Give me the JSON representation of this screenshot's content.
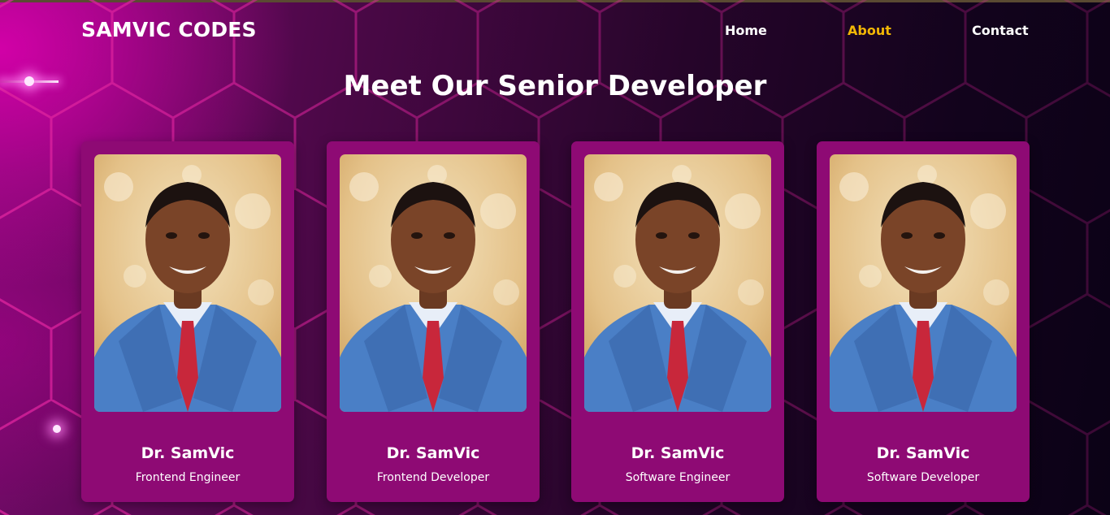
{
  "header": {
    "logo": "SAMVIC CODES",
    "nav": [
      {
        "label": "Home",
        "active": false
      },
      {
        "label": "About",
        "active": true
      },
      {
        "label": "Contact",
        "active": false
      }
    ]
  },
  "main": {
    "title": "Meet Our Senior Developer",
    "cards": [
      {
        "name": "Dr. SamVic",
        "role": "Frontend Engineer"
      },
      {
        "name": "Dr. SamVic",
        "role": "Frontend Developer"
      },
      {
        "name": "Dr. SamVic",
        "role": "Software Engineer"
      },
      {
        "name": "Dr. SamVic",
        "role": "Software Developer"
      }
    ]
  },
  "colors": {
    "accent_nav_active": "#f2b705",
    "card_background": "#8e0a74",
    "background_glow": "#d600aa",
    "background_dark": "#0b0216"
  }
}
